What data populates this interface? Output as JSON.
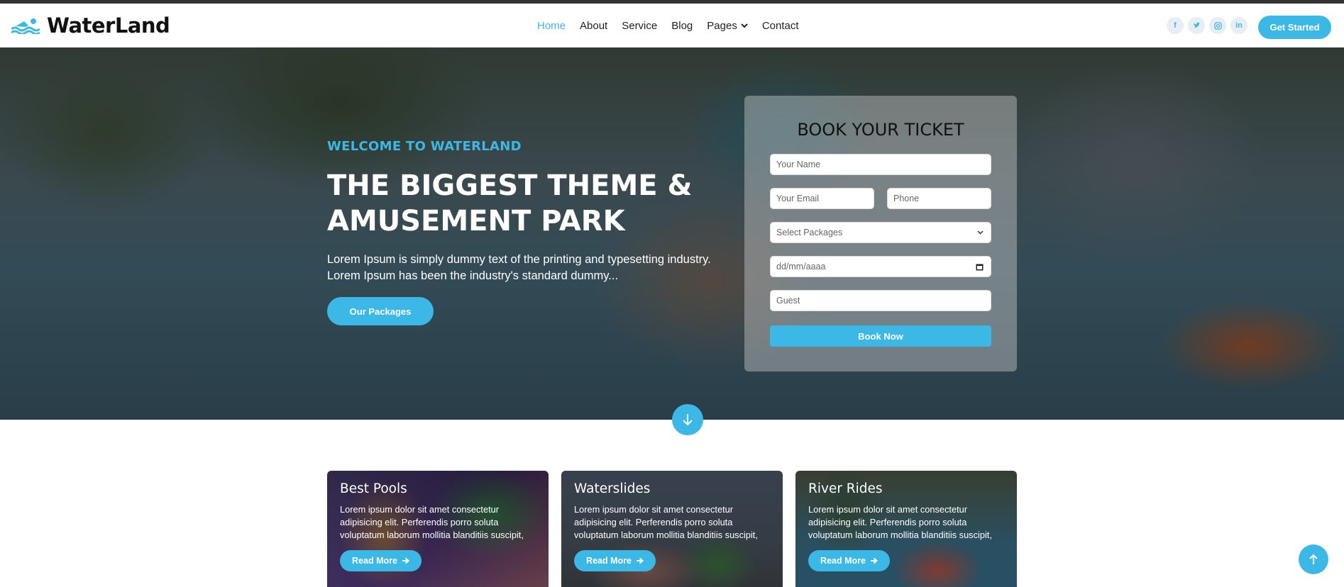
{
  "brand": {
    "name": "WaterLand",
    "accent": "#3cb8e6"
  },
  "nav": {
    "items": [
      {
        "label": "Home",
        "active": true
      },
      {
        "label": "About"
      },
      {
        "label": "Service"
      },
      {
        "label": "Blog"
      },
      {
        "label": "Pages",
        "dropdown": true
      },
      {
        "label": "Contact"
      }
    ],
    "socials": [
      "f",
      "t",
      "ig",
      "in"
    ],
    "cta": "Get Started"
  },
  "hero": {
    "subtitle": "WELCOME TO WATERLAND",
    "title": "THE BIGGEST THEME & AMUSEMENT PARK",
    "description": "Lorem Ipsum is simply dummy text of the printing and typesetting industry. Lorem Ipsum has been the industry's standard dummy...",
    "button": "Our Packages"
  },
  "booking": {
    "title": "BOOK YOUR TICKET",
    "name_placeholder": "Your Name",
    "email_placeholder": "Your Email",
    "phone_placeholder": "Phone",
    "package_placeholder": "Select Packages",
    "date_placeholder": "dd/mm/aaaa",
    "guest_placeholder": "Guest",
    "submit": "Book Now"
  },
  "cards": [
    {
      "title": "Best Pools",
      "text": "Lorem ipsum dolor sit amet consectetur adipisicing elit. Perferendis porro soluta voluptatum laborum mollitia blanditiis suscipit,",
      "button": "Read More"
    },
    {
      "title": "Waterslides",
      "text": "Lorem ipsum dolor sit amet consectetur adipisicing elit. Perferendis porro soluta voluptatum laborum mollitia blanditiis suscipit,",
      "button": "Read More"
    },
    {
      "title": "River Rides",
      "text": "Lorem ipsum dolor sit amet consectetur adipisicing elit. Perferendis porro soluta voluptatum laborum mollitia blanditiis suscipit,",
      "button": "Read More"
    }
  ]
}
